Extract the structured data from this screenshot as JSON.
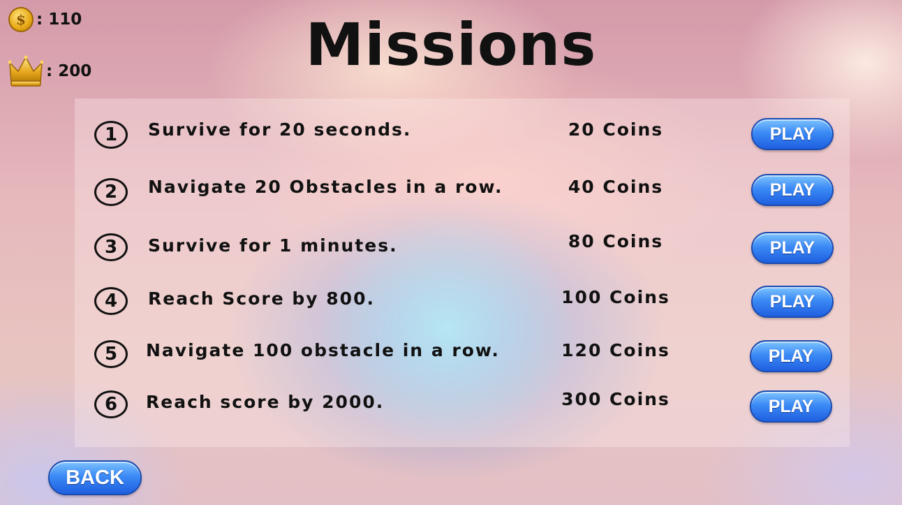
{
  "hud": {
    "coins": {
      "icon": "dollar-coin-icon",
      "value": ": 110"
    },
    "crowns": {
      "icon": "crown-icon",
      "value": ": 200"
    }
  },
  "title": "Missions",
  "missions": [
    {
      "number": "1",
      "text": "Survive for 20 seconds.",
      "reward": "20 Coins",
      "button": "PLAY"
    },
    {
      "number": "2",
      "text": "Navigate 20 Obstacles in a row.",
      "reward": "40 Coins",
      "button": "PLAY"
    },
    {
      "number": "3",
      "text": "Survive for 1 minutes.",
      "reward": "80 Coins",
      "button": "PLAY"
    },
    {
      "number": "4",
      "text": "Reach Score by 800.",
      "reward": "100 Coins",
      "button": "PLAY"
    },
    {
      "number": "5",
      "text": "Navigate 100 obstacle in a row.",
      "reward": "120 Coins",
      "button": "PLAY"
    },
    {
      "number": "6",
      "text": "Reach score by 2000.",
      "reward": "300 Coins",
      "button": "PLAY"
    }
  ],
  "back_button": "BACK",
  "colors": {
    "button_blue": "#3b8af5",
    "text": "#111111",
    "coin_gold": "#e7a816"
  }
}
